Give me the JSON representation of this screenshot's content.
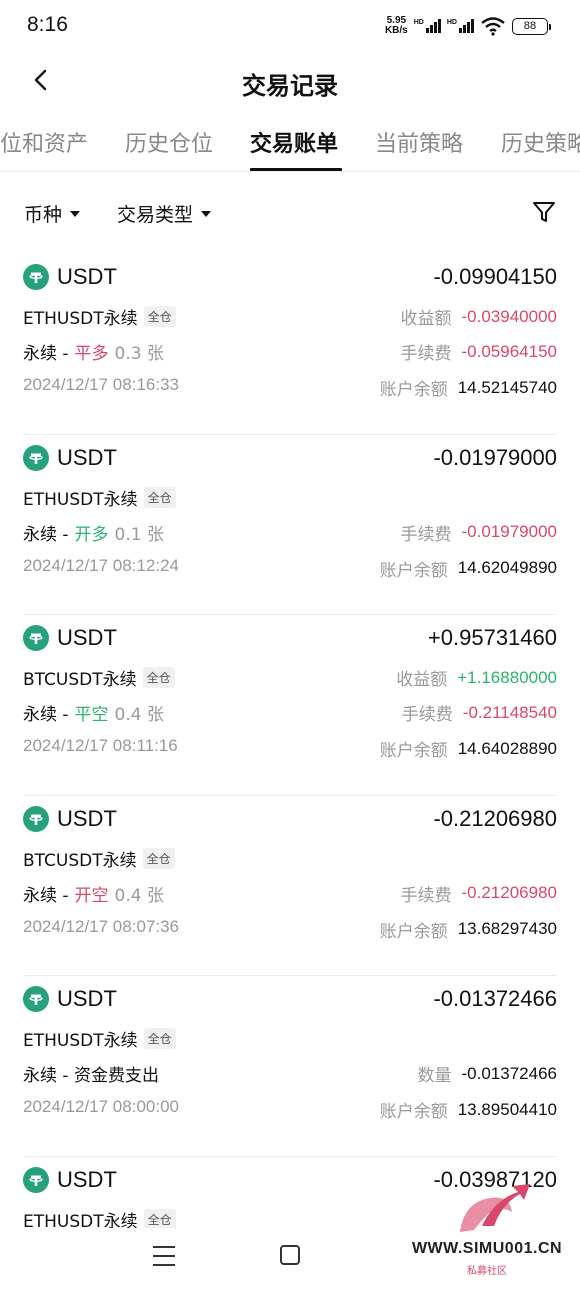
{
  "status": {
    "time": "8:16",
    "net_speed_value": "5.95",
    "net_speed_unit": "KB/s",
    "hd1": "HD",
    "hd2": "HD",
    "battery": "88"
  },
  "nav": {
    "title": "交易记录"
  },
  "tabs": [
    "位和资产",
    "历史仓位",
    "交易账单",
    "当前策略",
    "历史策略"
  ],
  "active_tab": "交易账单",
  "filters": {
    "coin": "币种",
    "type": "交易类型"
  },
  "records": [
    {
      "coin": "USDT",
      "amount": "-0.09904150",
      "symbol": "ETHUSDT永续",
      "margin": "全仓",
      "prefix": "永续 -",
      "action": "平多",
      "action_color": "red",
      "qty": "0.3 张",
      "date": "2024/12/17 08:16:33",
      "rows": [
        {
          "label": "收益额",
          "value": "-0.03940000",
          "color": "red"
        },
        {
          "label": "手续费",
          "value": "-0.05964150",
          "color": "red"
        },
        {
          "label": "账户余额",
          "value": "14.52145740",
          "color": ""
        }
      ]
    },
    {
      "coin": "USDT",
      "amount": "-0.01979000",
      "symbol": "ETHUSDT永续",
      "margin": "全仓",
      "prefix": "永续 -",
      "action": "开多",
      "action_color": "green",
      "qty": "0.1 张",
      "date": "2024/12/17 08:12:24",
      "rows": [
        {
          "label": "手续费",
          "value": "-0.01979000",
          "color": "red"
        },
        {
          "label": "账户余额",
          "value": "14.62049890",
          "color": ""
        }
      ]
    },
    {
      "coin": "USDT",
      "amount": "+0.95731460",
      "symbol": "BTCUSDT永续",
      "margin": "全仓",
      "prefix": "永续 -",
      "action": "平空",
      "action_color": "green",
      "qty": "0.4 张",
      "date": "2024/12/17 08:11:16",
      "rows": [
        {
          "label": "收益额",
          "value": "+1.16880000",
          "color": "green"
        },
        {
          "label": "手续费",
          "value": "-0.21148540",
          "color": "red"
        },
        {
          "label": "账户余额",
          "value": "14.64028890",
          "color": ""
        }
      ]
    },
    {
      "coin": "USDT",
      "amount": "-0.21206980",
      "symbol": "BTCUSDT永续",
      "margin": "全仓",
      "prefix": "永续 -",
      "action": "开空",
      "action_color": "red",
      "qty": "0.4 张",
      "date": "2024/12/17 08:07:36",
      "rows": [
        {
          "label": "手续费",
          "value": "-0.21206980",
          "color": "red"
        },
        {
          "label": "账户余额",
          "value": "13.68297430",
          "color": ""
        }
      ]
    },
    {
      "coin": "USDT",
      "amount": "-0.01372466",
      "symbol": "ETHUSDT永续",
      "margin": "全仓",
      "prefix": "永续 - 资金费支出",
      "action": "",
      "action_color": "",
      "qty": "",
      "date": "2024/12/17 08:00:00",
      "rows": [
        {
          "label": "数量",
          "value": "-0.01372466",
          "color": ""
        },
        {
          "label": "账户余额",
          "value": "13.89504410",
          "color": ""
        }
      ]
    },
    {
      "coin": "USDT",
      "amount": "-0.03987120",
      "symbol": "ETHUSDT永续",
      "margin": "全仓",
      "prefix": "",
      "action": "",
      "action_color": "",
      "qty": "",
      "date": "",
      "rows": []
    }
  ],
  "watermark": {
    "text": "WWW.SIMU001.CN",
    "sub": "私募社区"
  },
  "colors": {
    "red": "#d9486a",
    "green": "#2db36d",
    "tether": "#26a17b"
  },
  "icons": [
    "back-arrow-icon",
    "filter-funnel-icon",
    "tether-icon",
    "menu-icon",
    "home-icon"
  ]
}
